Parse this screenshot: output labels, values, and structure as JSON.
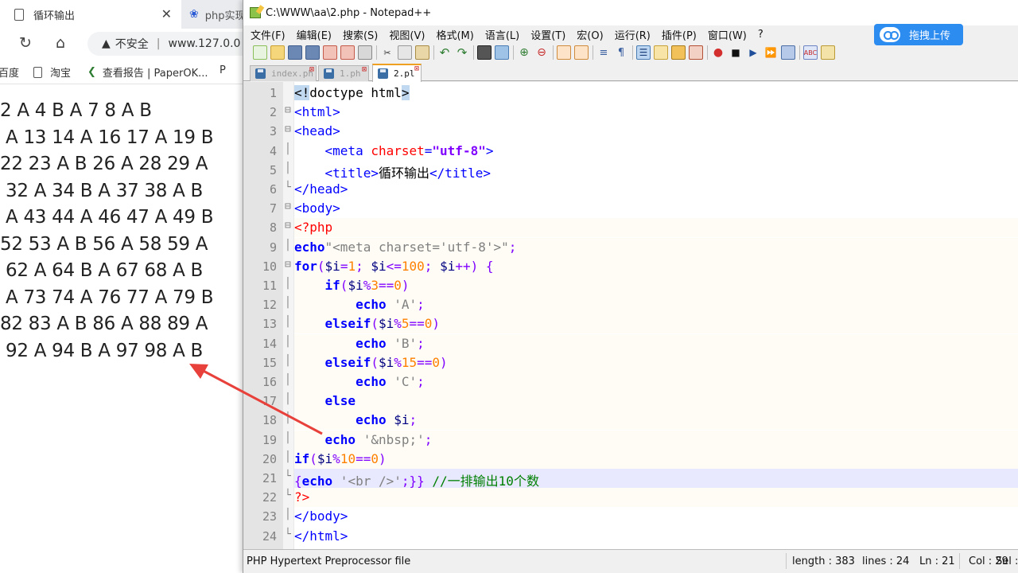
{
  "browser": {
    "tabs": [
      {
        "label": "循环输出",
        "close": "✕"
      },
      {
        "label": "php实现"
      }
    ],
    "security_label": "不安全",
    "address": "www.127.0.0",
    "bookmarks": [
      {
        "label": "百度"
      },
      {
        "label": "淘宝"
      },
      {
        "label": "查看报告 | PaperOK..."
      },
      {
        "label": "P"
      }
    ],
    "output_lines": [
      "2 A 4 B A 7 8 A B",
      " A 13 14 A 16 17 A 19 B",
      "22 23 A B 26 A 28 29 A",
      " 32 A 34 B A 37 38 A B",
      " A 43 44 A 46 47 A 49 B",
      "52 53 A B 56 A 58 59 A",
      " 62 A 64 B A 67 68 A B",
      " A 73 74 A 76 77 A 79 B",
      "82 83 A B 86 A 88 89 A",
      " 92 A 94 B A 97 98 A B"
    ]
  },
  "notepad": {
    "title": "C:\\WWW\\aa\\2.php - Notepad++",
    "menu": [
      "文件(F)",
      "编辑(E)",
      "搜索(S)",
      "视图(V)",
      "格式(M)",
      "语言(L)",
      "设置(T)",
      "宏(O)",
      "运行(R)",
      "插件(P)",
      "窗口(W)",
      "?"
    ],
    "upload_button": "拖拽上传",
    "file_tabs": [
      {
        "label": "index.ph",
        "active": false
      },
      {
        "label": "1.ph",
        "active": false
      },
      {
        "label": "2.pl",
        "active": true
      }
    ],
    "line_numbers": [
      "1",
      "2",
      "3",
      "4",
      "5",
      "6",
      "7",
      "8",
      "9",
      "10",
      "11",
      "12",
      "13",
      "14",
      "15",
      "16",
      "17",
      "18",
      "19",
      "20",
      "21",
      "22",
      "23",
      "24"
    ],
    "fold_markers": [
      "",
      "⊟",
      "⊟",
      "│",
      "│",
      "└",
      "⊟",
      "⊟",
      "│",
      "⊟",
      "│",
      "│",
      "│",
      "│",
      "│",
      "│",
      "│",
      "│",
      "│",
      "│",
      "└",
      "└",
      "│",
      "└"
    ],
    "code": [
      [
        {
          "t": "<!",
          "c": "t-doc"
        },
        {
          "t": "doctype html",
          "c": "t-txt"
        },
        {
          "t": ">",
          "c": "t-doc"
        }
      ],
      [
        {
          "t": "<html>",
          "c": "t-tag"
        }
      ],
      [
        {
          "t": "<head>",
          "c": "t-tag"
        }
      ],
      [
        {
          "t": "    ",
          "c": "t-txt"
        },
        {
          "t": "<meta ",
          "c": "t-tag"
        },
        {
          "t": "charset",
          "c": "t-attr"
        },
        {
          "t": "=",
          "c": "t-tag"
        },
        {
          "t": "\"utf-8\"",
          "c": "t-str"
        },
        {
          "t": ">",
          "c": "t-tag"
        }
      ],
      [
        {
          "t": "    ",
          "c": "t-txt"
        },
        {
          "t": "<title>",
          "c": "t-tag"
        },
        {
          "t": "循环输出",
          "c": "t-txt"
        },
        {
          "t": "</title>",
          "c": "t-tag"
        }
      ],
      [
        {
          "t": "</head>",
          "c": "t-tag"
        }
      ],
      [
        {
          "t": "<body>",
          "c": "t-tag"
        }
      ],
      [
        {
          "t": "<?php",
          "c": "t-php"
        }
      ],
      [
        {
          "t": "echo",
          "c": "t-kw"
        },
        {
          "t": "\"<meta charset='utf-8'>\"",
          "c": "t-pstr"
        },
        {
          "t": ";",
          "c": "t-op"
        }
      ],
      [
        {
          "t": "for",
          "c": "t-kw"
        },
        {
          "t": "(",
          "c": "t-op"
        },
        {
          "t": "$i",
          "c": "t-var"
        },
        {
          "t": "=",
          "c": "t-op"
        },
        {
          "t": "1",
          "c": "t-num"
        },
        {
          "t": "; ",
          "c": "t-op"
        },
        {
          "t": "$i",
          "c": "t-var"
        },
        {
          "t": "<=",
          "c": "t-op"
        },
        {
          "t": "100",
          "c": "t-num"
        },
        {
          "t": "; ",
          "c": "t-op"
        },
        {
          "t": "$i",
          "c": "t-var"
        },
        {
          "t": "++) {",
          "c": "t-op"
        }
      ],
      [
        {
          "t": "    ",
          "c": "t-txt"
        },
        {
          "t": "if",
          "c": "t-kw"
        },
        {
          "t": "(",
          "c": "t-op"
        },
        {
          "t": "$i",
          "c": "t-var"
        },
        {
          "t": "%",
          "c": "t-op"
        },
        {
          "t": "3",
          "c": "t-num"
        },
        {
          "t": "==",
          "c": "t-op"
        },
        {
          "t": "0",
          "c": "t-num"
        },
        {
          "t": ")",
          "c": "t-op"
        }
      ],
      [
        {
          "t": "        ",
          "c": "t-txt"
        },
        {
          "t": "echo",
          "c": "t-kw"
        },
        {
          "t": " 'A'",
          "c": "t-pstr"
        },
        {
          "t": ";",
          "c": "t-op"
        }
      ],
      [
        {
          "t": "    ",
          "c": "t-txt"
        },
        {
          "t": "elseif",
          "c": "t-kw"
        },
        {
          "t": "(",
          "c": "t-op"
        },
        {
          "t": "$i",
          "c": "t-var"
        },
        {
          "t": "%",
          "c": "t-op"
        },
        {
          "t": "5",
          "c": "t-num"
        },
        {
          "t": "==",
          "c": "t-op"
        },
        {
          "t": "0",
          "c": "t-num"
        },
        {
          "t": ")",
          "c": "t-op"
        }
      ],
      [
        {
          "t": "        ",
          "c": "t-txt"
        },
        {
          "t": "echo",
          "c": "t-kw"
        },
        {
          "t": " 'B'",
          "c": "t-pstr"
        },
        {
          "t": ";",
          "c": "t-op"
        }
      ],
      [
        {
          "t": "    ",
          "c": "t-txt"
        },
        {
          "t": "elseif",
          "c": "t-kw"
        },
        {
          "t": "(",
          "c": "t-op"
        },
        {
          "t": "$i",
          "c": "t-var"
        },
        {
          "t": "%",
          "c": "t-op"
        },
        {
          "t": "15",
          "c": "t-num"
        },
        {
          "t": "==",
          "c": "t-op"
        },
        {
          "t": "0",
          "c": "t-num"
        },
        {
          "t": ")",
          "c": "t-op"
        }
      ],
      [
        {
          "t": "        ",
          "c": "t-txt"
        },
        {
          "t": "echo",
          "c": "t-kw"
        },
        {
          "t": " 'C'",
          "c": "t-pstr"
        },
        {
          "t": ";",
          "c": "t-op"
        }
      ],
      [
        {
          "t": "    ",
          "c": "t-txt"
        },
        {
          "t": "else",
          "c": "t-kw"
        }
      ],
      [
        {
          "t": "        ",
          "c": "t-txt"
        },
        {
          "t": "echo",
          "c": "t-kw"
        },
        {
          "t": " ",
          "c": "t-txt"
        },
        {
          "t": "$i",
          "c": "t-var"
        },
        {
          "t": ";",
          "c": "t-op"
        }
      ],
      [
        {
          "t": "    ",
          "c": "t-txt"
        },
        {
          "t": "echo",
          "c": "t-kw"
        },
        {
          "t": " '&nbsp;'",
          "c": "t-pstr"
        },
        {
          "t": ";",
          "c": "t-op"
        }
      ],
      [
        {
          "t": "if",
          "c": "t-kw"
        },
        {
          "t": "(",
          "c": "t-op"
        },
        {
          "t": "$i",
          "c": "t-var"
        },
        {
          "t": "%",
          "c": "t-op"
        },
        {
          "t": "10",
          "c": "t-num"
        },
        {
          "t": "==",
          "c": "t-op"
        },
        {
          "t": "0",
          "c": "t-num"
        },
        {
          "t": ")",
          "c": "t-op"
        }
      ],
      [
        {
          "t": "{",
          "c": "t-op"
        },
        {
          "t": "echo",
          "c": "t-kw"
        },
        {
          "t": " '<br />'",
          "c": "t-pstr"
        },
        {
          "t": ";}} ",
          "c": "t-op"
        },
        {
          "t": "//一排输出10个数",
          "c": "t-cmt"
        }
      ],
      [
        {
          "t": "?>",
          "c": "t-php"
        }
      ],
      [
        {
          "t": "</body>",
          "c": "t-tag"
        }
      ],
      [
        {
          "t": "</html>",
          "c": "t-tag"
        }
      ]
    ],
    "status": {
      "file_type": "PHP Hypertext Preprocessor file",
      "length": "length : 383",
      "lines": "lines : 24",
      "ln": "Ln : 21",
      "col": "Col : 29",
      "sel": "Sel :"
    }
  },
  "colors": {
    "arrow": "#e8403a",
    "upload_button": "#2d8cf0",
    "current_line": "#e8e8ff"
  }
}
